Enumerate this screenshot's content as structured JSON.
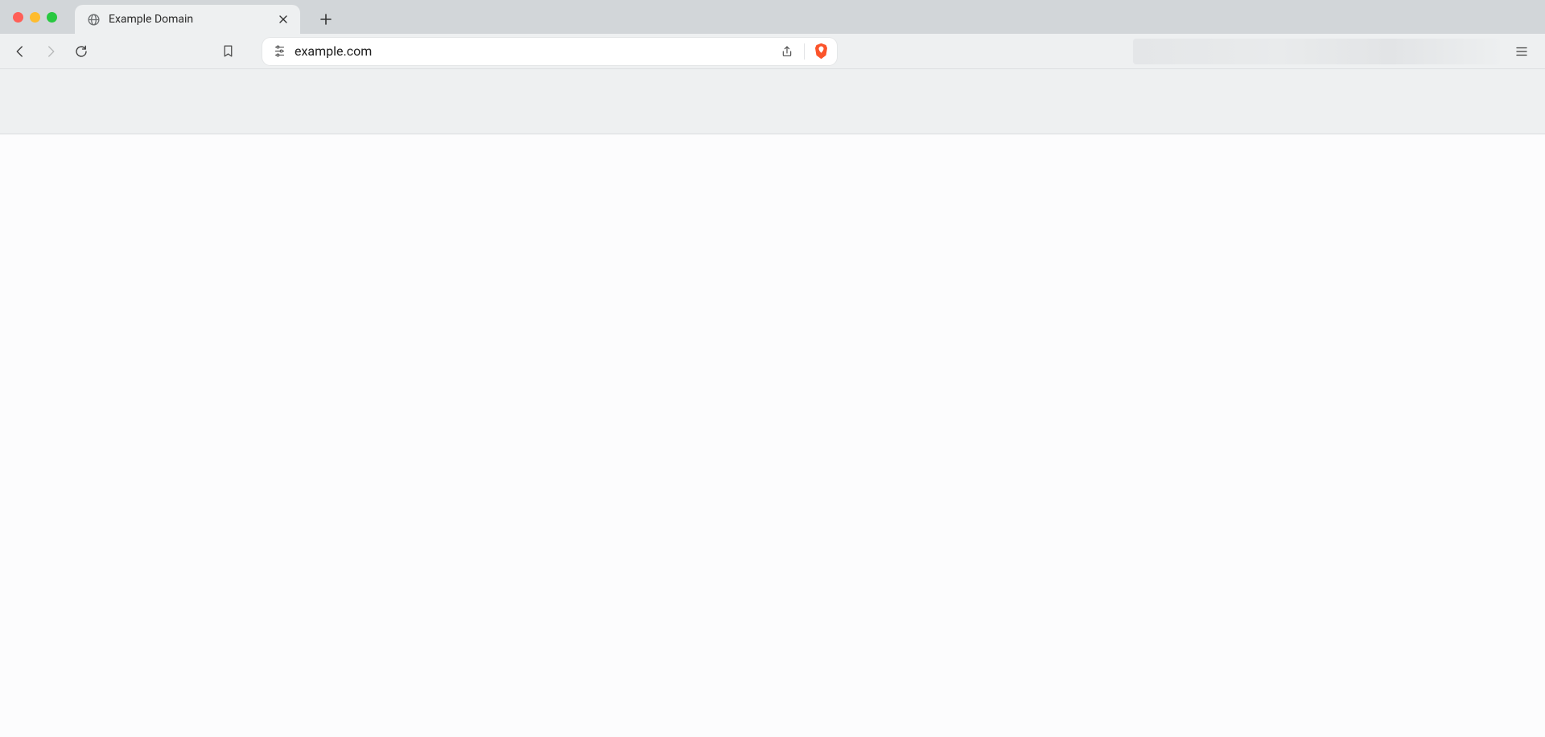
{
  "tab": {
    "title": "Example Domain"
  },
  "address_bar": {
    "url": "example.com"
  },
  "icons": {
    "globe": "globe-icon",
    "close": "close-icon",
    "plus": "plus-icon",
    "back": "back-icon",
    "forward": "forward-icon",
    "reload": "reload-icon",
    "bookmark": "bookmark-icon",
    "site_settings": "site-settings-icon",
    "share": "share-icon",
    "shield": "brave-shield-icon",
    "menu": "hamburger-icon"
  },
  "colors": {
    "tabstrip_bg": "#d2d6d9",
    "toolbar_bg": "#eef0f1",
    "content_bg": "#fcfcfd",
    "brave_orange": "#fb542b"
  }
}
